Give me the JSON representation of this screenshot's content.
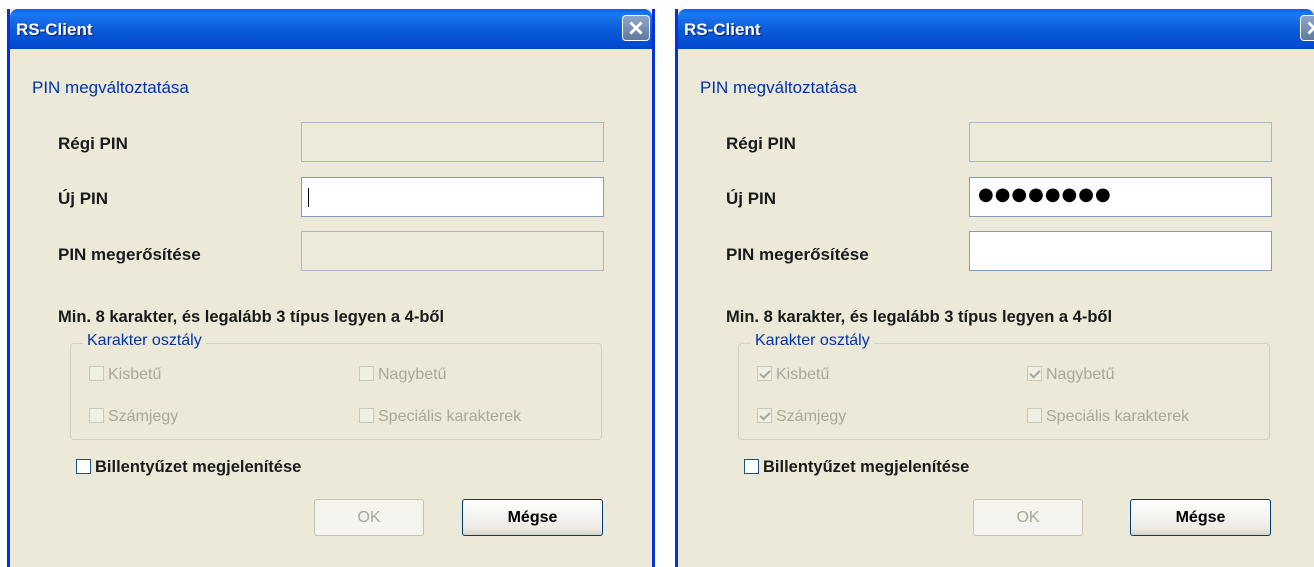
{
  "dialogs": [
    {
      "title": "RS-Client",
      "section_title": "PIN megváltoztatása",
      "labels": {
        "old_pin": "Régi PIN",
        "new_pin": "Új PIN",
        "confirm_pin": "PIN megerősítése"
      },
      "fields": {
        "old_pin": "",
        "new_pin": "",
        "confirm_pin": ""
      },
      "hint": "Min. 8 karakter, és legalább 3 típus legyen a 4-ből",
      "group_title": "Karakter osztály",
      "checkboxes": {
        "lowercase": {
          "label": "Kisbetű",
          "checked": false
        },
        "uppercase": {
          "label": "Nagybetű",
          "checked": false
        },
        "digit": {
          "label": "Számjegy",
          "checked": false
        },
        "special": {
          "label": "Speciális karakterek",
          "checked": false
        }
      },
      "keyboard_label": "Billentyűzet megjelenítése",
      "ok_label": "OK",
      "cancel_label": "Mégse"
    },
    {
      "title": "RS-Client",
      "section_title": "PIN megváltoztatása",
      "labels": {
        "old_pin": "Régi PIN",
        "new_pin": "Új PIN",
        "confirm_pin": "PIN megerősítése"
      },
      "fields": {
        "old_pin": "",
        "new_pin": "●●●●●●●●",
        "confirm_pin": ""
      },
      "hint": "Min. 8 karakter, és legalább 3 típus legyen a 4-ből",
      "group_title": "Karakter osztály",
      "checkboxes": {
        "lowercase": {
          "label": "Kisbetű",
          "checked": true
        },
        "uppercase": {
          "label": "Nagybetű",
          "checked": true
        },
        "digit": {
          "label": "Számjegy",
          "checked": true
        },
        "special": {
          "label": "Speciális karakterek",
          "checked": false
        }
      },
      "keyboard_label": "Billentyűzet megjelenítése",
      "ok_label": "OK",
      "cancel_label": "Mégse"
    }
  ],
  "icons": {
    "close": "close-icon"
  },
  "colors": {
    "titlebar": "#0a5ad8",
    "section_title": "#0033aa",
    "dialog_bg": "#ece9d8"
  }
}
